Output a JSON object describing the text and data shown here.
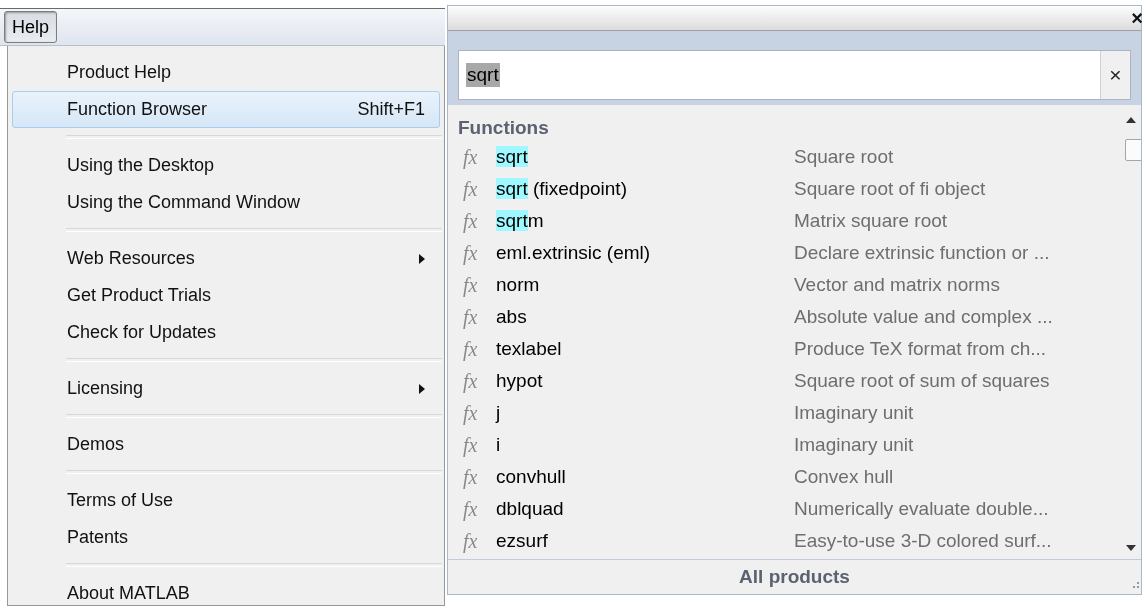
{
  "menu_bar": {
    "menus": [
      {
        "label": "Help",
        "selected": true
      }
    ]
  },
  "help_menu": {
    "items": [
      {
        "kind": "item",
        "label": "Product Help",
        "selected": false
      },
      {
        "kind": "item",
        "label": "Function Browser",
        "shortcut": "Shift+F1",
        "selected": true
      },
      {
        "kind": "separator"
      },
      {
        "kind": "item",
        "label": "Using the Desktop",
        "selected": false
      },
      {
        "kind": "item",
        "label": "Using the Command Window",
        "selected": false
      },
      {
        "kind": "separator"
      },
      {
        "kind": "item",
        "label": "Web Resources",
        "submenu": true,
        "selected": false
      },
      {
        "kind": "item",
        "label": "Get Product Trials",
        "selected": false
      },
      {
        "kind": "item",
        "label": "Check for Updates",
        "selected": false
      },
      {
        "kind": "separator"
      },
      {
        "kind": "item",
        "label": "Licensing",
        "submenu": true,
        "selected": false
      },
      {
        "kind": "separator"
      },
      {
        "kind": "item",
        "label": "Demos",
        "selected": false
      },
      {
        "kind": "separator"
      },
      {
        "kind": "item",
        "label": "Terms of Use",
        "selected": false
      },
      {
        "kind": "item",
        "label": "Patents",
        "selected": false
      },
      {
        "kind": "separator"
      },
      {
        "kind": "item",
        "label": "About MATLAB",
        "selected": false
      }
    ]
  },
  "function_browser": {
    "close": "×",
    "search": {
      "value": "sqrt",
      "clear": "×"
    },
    "section": "Functions",
    "rows": [
      {
        "icon": "fx",
        "match": "sqrt",
        "name": "",
        "description": "Square root"
      },
      {
        "icon": "fx",
        "match": "sqrt",
        "name": " (fixedpoint)",
        "description": "Square root of fi object"
      },
      {
        "icon": "fx",
        "match": "sqrt",
        "name": "m",
        "description": "Matrix square root"
      },
      {
        "icon": "fx",
        "name": "eml.extrinsic (eml)",
        "description": "Declare extrinsic function or ..."
      },
      {
        "icon": "fx",
        "name": "norm",
        "description": "Vector and matrix norms"
      },
      {
        "icon": "fx",
        "name": "abs",
        "description": "Absolute value and complex ..."
      },
      {
        "icon": "fx",
        "name": "texlabel",
        "description": "Produce TeX format from ch..."
      },
      {
        "icon": "fx",
        "name": "hypot",
        "description": "Square root of sum of squares"
      },
      {
        "icon": "fx",
        "name": "j",
        "description": "Imaginary unit"
      },
      {
        "icon": "fx",
        "name": "i",
        "description": "Imaginary unit"
      },
      {
        "icon": "fx",
        "name": "convhull",
        "description": "Convex hull"
      },
      {
        "icon": "fx",
        "name": "dblquad",
        "description": "Numerically evaluate double..."
      },
      {
        "icon": "fx",
        "name": "ezsurf",
        "description": "Easy-to-use 3-D colored surf..."
      }
    ],
    "footer": "All products"
  }
}
